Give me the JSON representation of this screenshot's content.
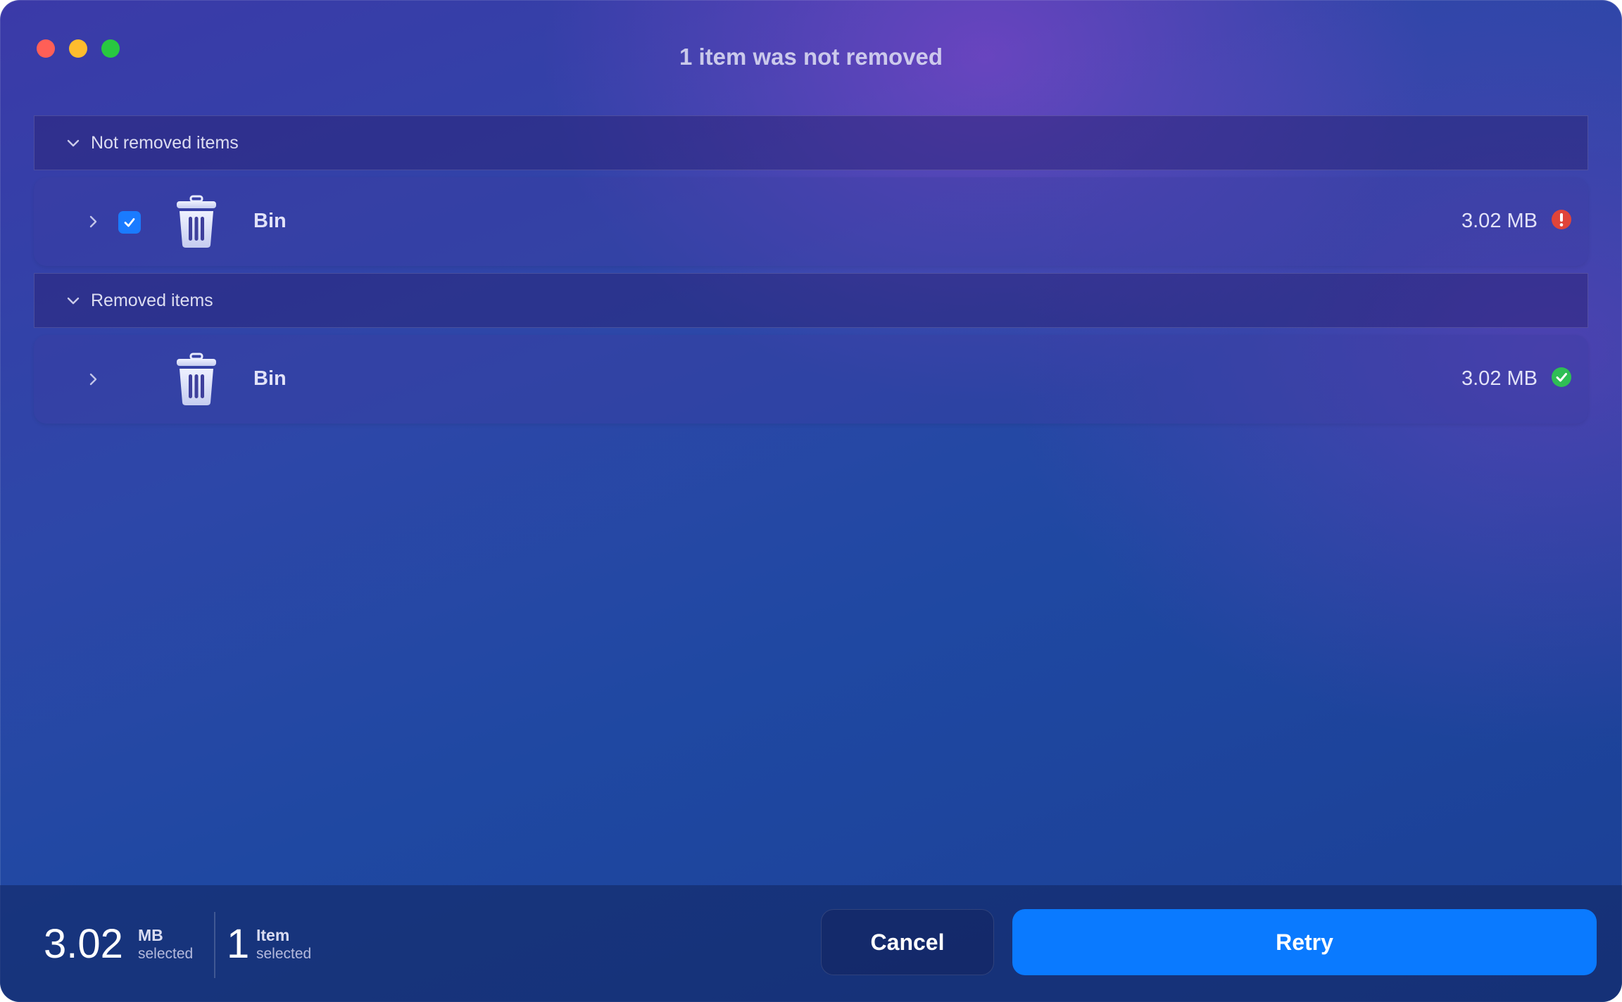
{
  "window": {
    "title": "1 item was not removed"
  },
  "sections": [
    {
      "label": "Not removed items",
      "items": [
        {
          "name": "Bin",
          "size": "3.02 MB",
          "checked": true,
          "status": "error"
        }
      ]
    },
    {
      "label": "Removed items",
      "items": [
        {
          "name": "Bin",
          "size": "3.02 MB",
          "checked": false,
          "status": "ok"
        }
      ]
    }
  ],
  "footer": {
    "size_value": "3.02",
    "size_unit": "MB",
    "size_sub": "selected",
    "count_value": "1",
    "count_unit": "Item",
    "count_sub": "selected",
    "cancel_label": "Cancel",
    "retry_label": "Retry"
  },
  "colors": {
    "accent": "#0a7aff",
    "error": "#e0443a",
    "success": "#2fbe55"
  },
  "icons": {
    "expand": "chevron-right-icon",
    "collapse": "chevron-down-icon",
    "item": "trash-bin-icon",
    "error": "exclamation-icon",
    "ok": "checkmark-icon"
  }
}
